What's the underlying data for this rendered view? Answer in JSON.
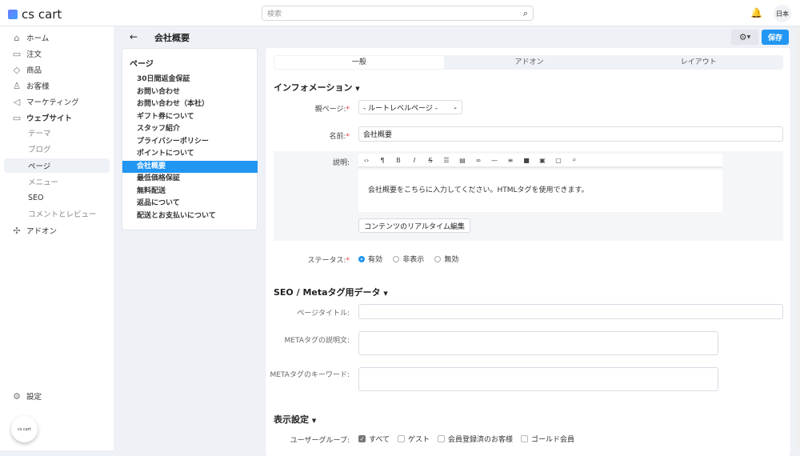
{
  "header": {
    "logo": "cs cart",
    "search_placeholder": "検索",
    "lang": "日本"
  },
  "sidebar": {
    "items": [
      {
        "label": "ホーム",
        "icon": "home-icon"
      },
      {
        "label": "注文",
        "icon": "inbox-icon"
      },
      {
        "label": "商品",
        "icon": "tag-icon"
      },
      {
        "label": "お客様",
        "icon": "user-icon"
      },
      {
        "label": "マーケティング",
        "icon": "megaphone-icon"
      },
      {
        "label": "ウェブサイト",
        "icon": "monitor-icon"
      }
    ],
    "website_sub": [
      "テーマ",
      "ブログ",
      "ページ",
      "メニュー",
      "SEO",
      "コメントとレビュー"
    ],
    "addons": "アドオン",
    "settings": "設定",
    "bubble": "cs cart"
  },
  "page_header": {
    "title": "会社概要",
    "save": "保存"
  },
  "pages_panel": {
    "title": "ページ",
    "items": [
      "30日間返金保証",
      "お問い合わせ",
      "お問い合わせ（本社）",
      "ギフト券について",
      "スタッフ紹介",
      "プライバシーポリシー",
      "ポイントについて",
      "会社概要",
      "最低価格保証",
      "無料配送",
      "返品について",
      "配送とお支払いについて"
    ],
    "selected": "会社概要"
  },
  "tabs": [
    "一般",
    "アドオン",
    "レイアウト"
  ],
  "info": {
    "section": "インフォメーション",
    "parent_label": "親ページ:",
    "parent_value": "- ルートレベルページ -",
    "name_label": "名前:",
    "name_value": "会社概要",
    "desc_label": "説明:",
    "desc_text": "会社概要をこちらに入力してください。HTMLタグを使用できます。",
    "realtime_button": "コンテンツのリアルタイム編集",
    "status_label": "ステータス:",
    "status_options": [
      "有効",
      "非表示",
      "無効"
    ],
    "status_selected": "有効"
  },
  "seo": {
    "section": "SEO / Metaタグ用データ",
    "page_title_label": "ページタイトル:",
    "meta_desc_label": "METAタグの説明文:",
    "meta_kw_label": "METAタグのキーワード:"
  },
  "display": {
    "section": "表示設定",
    "usergroup_label": "ユーザーグループ:",
    "groups": [
      {
        "label": "すべて",
        "checked": true
      },
      {
        "label": "ゲスト",
        "checked": false
      },
      {
        "label": "会員登録済のお客様",
        "checked": false
      },
      {
        "label": "ゴールド会員",
        "checked": false
      }
    ]
  }
}
